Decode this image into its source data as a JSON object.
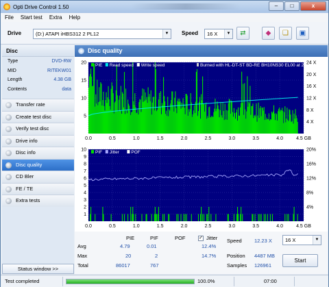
{
  "window": {
    "title": "Opti Drive Control 1.50",
    "buttons": [
      "–",
      "□",
      "x"
    ]
  },
  "menu": [
    "File",
    "Start test",
    "Extra",
    "Help"
  ],
  "toolbar": {
    "drive_label": "Drive",
    "drive_value": "(D:)    ATAPI iHBS312   2 PL12",
    "speed_label": "Speed",
    "speed_value": "16 X"
  },
  "disc": {
    "header": "Disc",
    "rows": [
      {
        "k": "Type",
        "v": "DVD-RW"
      },
      {
        "k": "MID",
        "v": "RITEKW01"
      },
      {
        "k": "Length",
        "v": "4.38 GB"
      },
      {
        "k": "Contents",
        "v": "data"
      }
    ]
  },
  "nav": [
    "Transfer rate",
    "Create test disc",
    "Verify test disc",
    "Drive info",
    "Disc info",
    "Disc quality",
    "CD Bler",
    "FE / TE",
    "Extra tests"
  ],
  "nav_active_index": 5,
  "status_window_label": "Status window >>",
  "panel": {
    "title": "Disc quality"
  },
  "chart_data": [
    {
      "type": "bar",
      "legend": [
        "PIE",
        "Read speed",
        "Write speed"
      ],
      "annotation": "Burned with HL-DT-ST BD-RE  BH10NS30 EL00 at 2X",
      "x_ticks": [
        "0.0",
        "0.5",
        "1.0",
        "1.5",
        "2.0",
        "2.5",
        "3.0",
        "3.5",
        "4.0",
        "4.5 GB"
      ],
      "y_left_ticks": [
        "20",
        "15",
        "10",
        "5"
      ],
      "y_right_ticks": [
        "24 X",
        "20 X",
        "16 X",
        "12 X",
        "8 X",
        "4 X"
      ],
      "xlim": [
        0,
        4.5
      ],
      "ylim": [
        0,
        20
      ],
      "y2lim": [
        0,
        24
      ],
      "pie_approx": {
        "x_range": [
          0.0,
          4.38
        ],
        "typical_max": 14,
        "peak": 20,
        "trend_start": 13,
        "trend_end": 6
      },
      "read_speed_line": {
        "x": [
          0.0,
          4.38
        ],
        "y_speed_x": [
          6.0,
          12.2
        ]
      },
      "colors": {
        "pie": "#00e000",
        "read_speed": "#00e8e8",
        "background": "#000080"
      }
    },
    {
      "type": "bar",
      "legend": [
        "PIF",
        "Jitter",
        "POF"
      ],
      "x_ticks": [
        "0.0",
        "0.5",
        "1.0",
        "1.5",
        "2.0",
        "2.5",
        "3.0",
        "3.5",
        "4.0",
        "4.5 GB"
      ],
      "y_left_ticks": [
        "10",
        "9",
        "8",
        "7",
        "6",
        "5",
        "4",
        "3",
        "2",
        "1"
      ],
      "y_right_ticks": [
        "20%",
        "16%",
        "12%",
        "8%",
        "4%"
      ],
      "xlim": [
        0,
        4.5
      ],
      "ylim": [
        0,
        10
      ],
      "y2lim": [
        0,
        20
      ],
      "pif_approx": {
        "typical_max": 1,
        "peak": 2
      },
      "jitter_line": {
        "x": [
          0.0,
          4.38
        ],
        "y_percent": [
          11.6,
          13.0
        ]
      },
      "colors": {
        "pif": "#00e000",
        "jitter": "#a8a8ff",
        "background": "#000080"
      }
    }
  ],
  "stats": {
    "cols": [
      "PIE",
      "PIF",
      "POF",
      "Jitter"
    ],
    "rows": [
      {
        "label": "Avg",
        "pie": "4.79",
        "pif": "0.01",
        "pof": "",
        "jitter": "12.4%"
      },
      {
        "label": "Max",
        "pie": "20",
        "pif": "2",
        "pof": "",
        "jitter": "14.7%"
      },
      {
        "label": "Total",
        "pie": "86017",
        "pif": "767",
        "pof": "",
        "jitter": ""
      }
    ],
    "jitter_checked": true,
    "speed_label": "Speed",
    "speed_value": "12.23 X",
    "speed_select": "16 X",
    "position_label": "Position",
    "position_value": "4487 MB",
    "samples_label": "Samples",
    "samples_value": "126961",
    "start_label": "Start"
  },
  "status": {
    "text": "Test completed",
    "percent": "100.0%",
    "progress": 1.0,
    "time": "07:00"
  }
}
